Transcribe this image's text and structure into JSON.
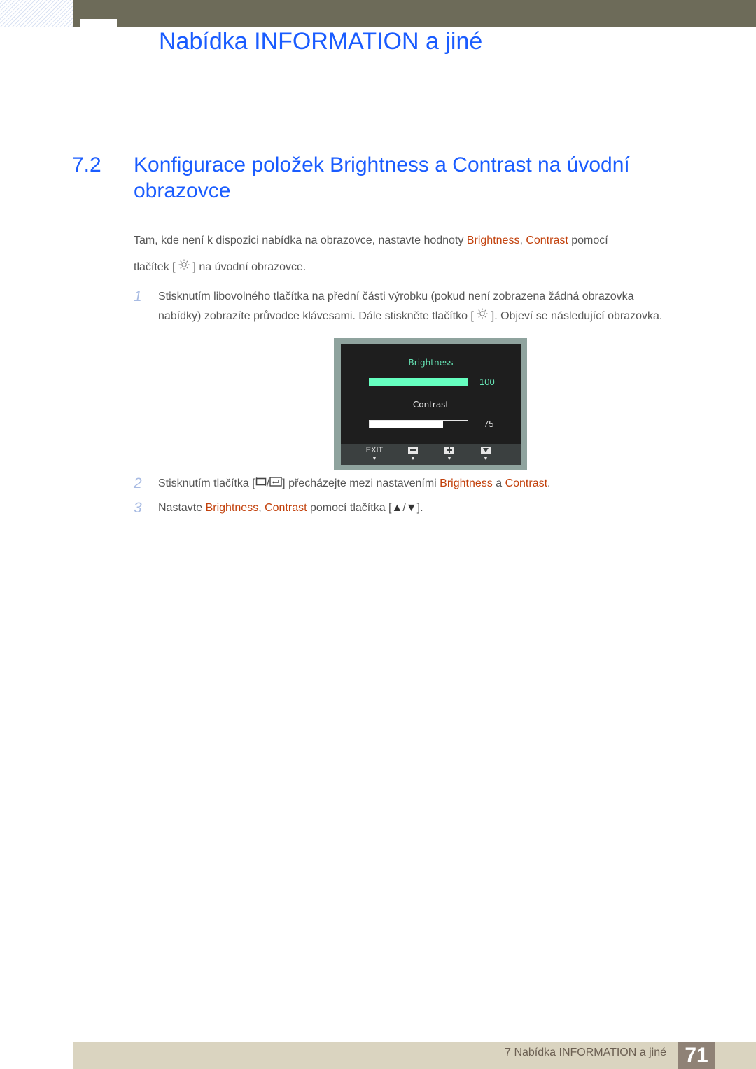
{
  "header": {
    "chapter_title": "Nabídka INFORMATION a jiné"
  },
  "section": {
    "number": "7.2",
    "title": "Konfigurace položek Brightness a Contrast na úvodní obrazovce"
  },
  "intro": {
    "part1": "Tam, kde není k dispozici nabídka na obrazovce, nastavte hodnoty ",
    "brightness": "Brightness",
    "comma": ", ",
    "contrast": "Contrast",
    "part2": " pomocí",
    "part3": "tlačítek [ ",
    "icon": "sun-icon",
    "part4": " ] na úvodní obrazovce."
  },
  "steps": [
    {
      "number": "1",
      "text1": "Stisknutím libovolného tlačítka na přední části výrobku (pokud není zobrazena žádná obrazovka",
      "text2": "nabídky) zobrazíte průvodce klávesami. Dále stiskněte tlačítko [ ",
      "icon": "sun-icon",
      "text3": " ]. Objeví se následující obrazovka."
    },
    {
      "number": "2",
      "text1": "Stisknutím tlačítka [",
      "icons": [
        "source-icon",
        "enter-icon"
      ],
      "sep": "/",
      "text2": "] přecházejte mezi nastaveními ",
      "brightness": "Brightness",
      "and": " a ",
      "contrast": "Contrast",
      "end": "."
    },
    {
      "number": "3",
      "text1": "Nastavte ",
      "brightness": "Brightness",
      "comma": ", ",
      "contrast": "Contrast",
      "text2": " pomocí tlačítka [",
      "up": "▲",
      "sep": "/",
      "down": "▼",
      "end": "]."
    }
  ],
  "osd": {
    "brightness_label": "Brightness",
    "brightness_value": "100",
    "brightness_fraction": 1.0,
    "contrast_label": "Contrast",
    "contrast_value": "75",
    "contrast_fraction": 0.75,
    "buttons": [
      {
        "label": "EXIT",
        "icon": "exit-text"
      },
      {
        "label": "",
        "icon": "minus-icon"
      },
      {
        "label": "",
        "icon": "plus-icon"
      },
      {
        "label": "",
        "icon": "down-icon"
      }
    ],
    "colors": {
      "brightness_accent": "#66ffc0",
      "frame": "#8fa39e"
    }
  },
  "footer": {
    "chapter_ref": "7 Nabídka INFORMATION a jiné",
    "page_number": "71"
  },
  "colors": {
    "heading_blue": "#1a5cff",
    "highlight_orange": "#c2410c",
    "step_number": "#a8bbe3"
  }
}
